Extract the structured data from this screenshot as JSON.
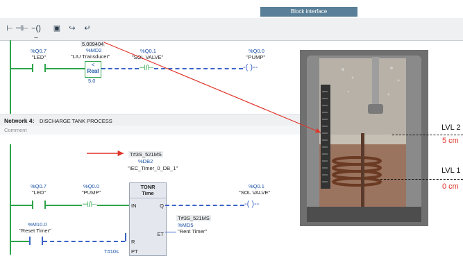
{
  "header": {
    "block_interface": "Block interface"
  },
  "toolbar": {
    "icons": [
      "rung-start-icon",
      "no-contact-icon",
      "coil-icon",
      "box-icon",
      "branch-open-icon",
      "branch-close-icon"
    ]
  },
  "network3": {
    "in1_addr": "%Q0.7",
    "in1_name": "\"LED\"",
    "cmp_addr": "%MD2",
    "cmp_name": "\"LIU Transducer\"",
    "cmp_live": "5.009404",
    "cmp_op": "<",
    "cmp_type": "Real",
    "cmp_const": "5.0",
    "in2_addr": "%Q0.1",
    "in2_name": "\"SOL VALVE\"",
    "out_addr": "%Q0.0",
    "out_name": "\"PUMP\""
  },
  "network4": {
    "title": "Network 4:",
    "subtitle": "DISCHARGE TANK PROCESS",
    "comment": "Comment",
    "timer_live": "T#3S_521MS",
    "timer_db": "%DB2",
    "timer_db_name": "\"IEC_Timer_0_DB_1\"",
    "timer_type": "TONR",
    "timer_sub": "Time",
    "pin_in": "IN",
    "pin_q": "Q",
    "pin_r": "R",
    "pin_pt": "PT",
    "pin_et": "ET",
    "in1_addr": "%Q0.7",
    "in1_name": "\"LED\"",
    "in2_addr": "%Q0.0",
    "in2_name": "\"PUMP\"",
    "out_addr": "%Q0.1",
    "out_name": "\"SOL VALVE\"",
    "reset_addr": "%M10.0",
    "reset_name": "\"Reset Timer\"",
    "et_live": "T#3S_521MS",
    "et_addr": "%MD5",
    "et_name": "\"Rent Timer\"",
    "pt_value": "T#10s"
  },
  "photo": {
    "lvl2": "LVL 2",
    "lvl2_cm": "5 cm",
    "lvl1": "LVL 1",
    "lvl1_cm": "0 cm"
  },
  "colors": {
    "wire": "#2ca44a",
    "dashed": "#3b63c8",
    "arrow": "#e0352b"
  }
}
